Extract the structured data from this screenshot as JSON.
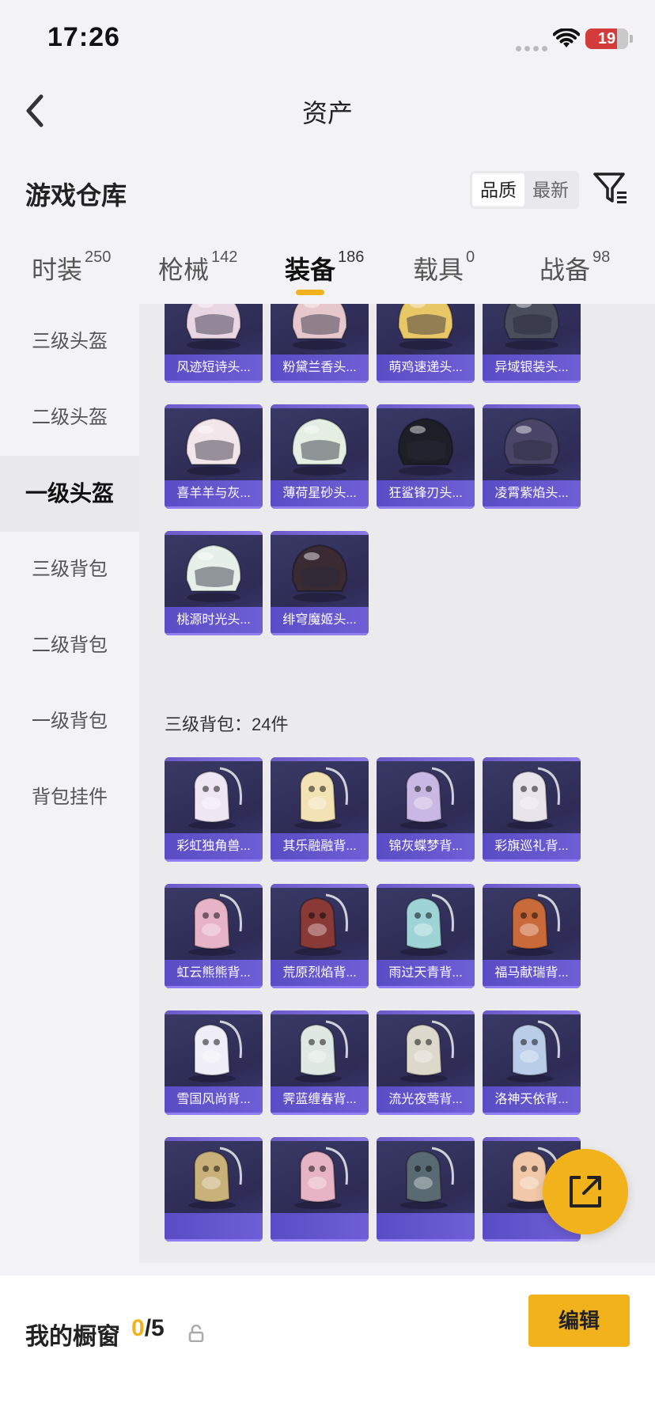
{
  "status": {
    "time": "17:26",
    "battery": "19"
  },
  "header": {
    "title": "资产"
  },
  "section": {
    "title": "游戏仓库",
    "sort_quality": "品质",
    "sort_newest": "最新"
  },
  "tabs": [
    {
      "label": "时装",
      "count": "250"
    },
    {
      "label": "枪械",
      "count": "142"
    },
    {
      "label": "装备",
      "count": "186"
    },
    {
      "label": "载具",
      "count": "0"
    },
    {
      "label": "战备",
      "count": "98"
    }
  ],
  "sidenav": [
    "三级头盔",
    "二级头盔",
    "一级头盔",
    "三级背包",
    "二级背包",
    "一级背包",
    "背包挂件"
  ],
  "helmets": [
    "风迹短诗头...",
    "粉黛兰香头...",
    "萌鸡速递头...",
    "异域银装头...",
    "喜羊羊与灰...",
    "薄荷星砂头...",
    "狂鲨锋刃头...",
    "凌霄紫焰头...",
    "桃源时光头...",
    "绯穹魔姬头..."
  ],
  "helmet_colors": [
    "#e9d6e3",
    "#e6c8cc",
    "#e8c766",
    "#4a4e5c",
    "#f2e6ea",
    "#e4eee2",
    "#1d1f26",
    "#4b4668",
    "#e6efe8",
    "#3a2a32"
  ],
  "backpack_group": "三级背包：24件",
  "backpacks": [
    "彩虹独角兽...",
    "其乐融融背...",
    "锦灰蝶梦背...",
    "彩旗巡礼背...",
    "虹云熊熊背...",
    "荒原烈焰背...",
    "雨过天青背...",
    "福马献瑞背...",
    "雪国风尚背...",
    "霁蓝缠春背...",
    "流光夜莺背...",
    "洛神天依背...",
    "",
    "",
    "",
    ""
  ],
  "backpack_colors": [
    "#efe6f4",
    "#f2e2b4",
    "#c9b8e4",
    "#e8e4ec",
    "#e7b3c6",
    "#8a3a36",
    "#9fd4d6",
    "#c96a3a",
    "#f0eef6",
    "#dfe8e2",
    "#ddd8cc",
    "#b9cce8",
    "#c9b27a",
    "#e6b4c4",
    "#5a6a72",
    "#f1c9a9"
  ],
  "bottom": {
    "label": "我的橱窗",
    "current": "0",
    "total": "/5",
    "edit": "编辑"
  }
}
